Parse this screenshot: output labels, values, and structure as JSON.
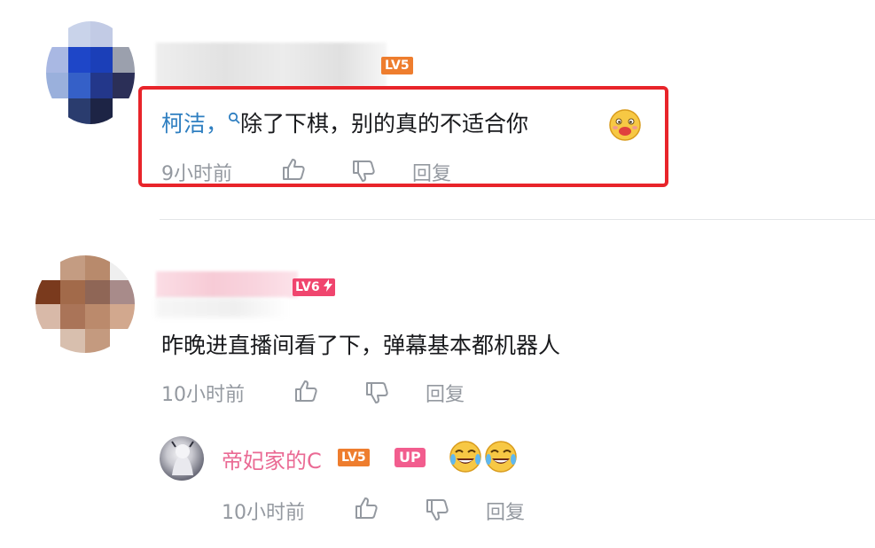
{
  "comments": [
    {
      "level": "LV5",
      "mention": "柯洁，",
      "text": "除了下棋，别的真的不适合你",
      "emoji": "awkward-face-emoji",
      "time": "9小时前",
      "reply_label": "回复"
    },
    {
      "level": "LV6",
      "text": "昨晚进直播间看了下，弹幕基本都机器人",
      "time": "10小时前",
      "reply_label": "回复",
      "replies": [
        {
          "username": "帝妃家的C",
          "level": "LV5",
          "badge": "UP",
          "emojis": [
            "crying-laughing-emoji",
            "crying-laughing-emoji"
          ],
          "time": "10小时前",
          "reply_label": "回复"
        }
      ]
    }
  ],
  "colors": {
    "highlight": "#e8242a",
    "mention": "#2f7fc1",
    "lv5": "#ee7d2e",
    "lv6": "#f0456e",
    "up_badge": "#f25d8e",
    "reply_username": "#ea6a94",
    "meta_text": "#9499a0"
  }
}
